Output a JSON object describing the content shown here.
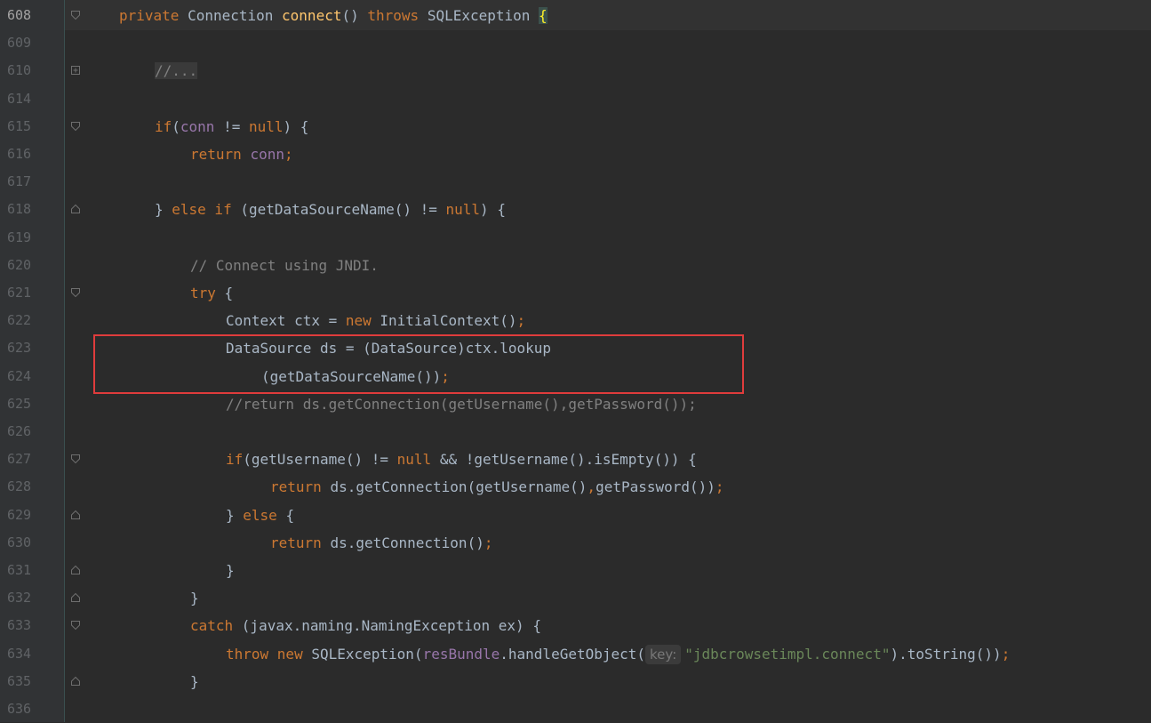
{
  "editor": {
    "lines": [
      {
        "num": "608",
        "current": true,
        "fold": "open",
        "indent": 0,
        "segments": [
          [
            "kw",
            "private "
          ],
          [
            "",
            "Connection "
          ],
          [
            "fn",
            "connect"
          ],
          [
            "",
            "() "
          ],
          [
            "kw",
            "throws "
          ],
          [
            "",
            "SQLException "
          ],
          [
            "brace-hl",
            "{"
          ]
        ]
      },
      {
        "num": "609",
        "fold": "none",
        "indent": 0,
        "segments": []
      },
      {
        "num": "610",
        "fold": "plus",
        "indent": 1,
        "segments": [
          [
            "folded",
            "//..."
          ]
        ]
      },
      {
        "num": "614",
        "fold": "none",
        "indent": 0,
        "segments": []
      },
      {
        "num": "615",
        "fold": "open",
        "indent": 1,
        "segments": [
          [
            "kw",
            "if"
          ],
          [
            "",
            "("
          ],
          [
            "field",
            "conn"
          ],
          [
            "",
            " != "
          ],
          [
            "kw",
            "null"
          ],
          [
            "",
            ") {"
          ]
        ]
      },
      {
        "num": "616",
        "fold": "none",
        "indent": 2,
        "segments": [
          [
            "kw",
            "return "
          ],
          [
            "field",
            "conn"
          ],
          [
            "kw",
            ";"
          ]
        ]
      },
      {
        "num": "617",
        "fold": "none",
        "indent": 0,
        "segments": []
      },
      {
        "num": "618",
        "fold": "close",
        "indent": 1,
        "segments": [
          [
            "",
            "} "
          ],
          [
            "kw",
            "else if "
          ],
          [
            "",
            "(getDataSourceName() != "
          ],
          [
            "kw",
            "null"
          ],
          [
            "",
            ") {"
          ]
        ]
      },
      {
        "num": "619",
        "fold": "none",
        "indent": 0,
        "segments": []
      },
      {
        "num": "620",
        "fold": "none",
        "indent": 2,
        "segments": [
          [
            "cm",
            "// Connect using JNDI."
          ]
        ]
      },
      {
        "num": "621",
        "fold": "open",
        "indent": 2,
        "segments": [
          [
            "kw",
            "try "
          ],
          [
            "",
            "{"
          ]
        ]
      },
      {
        "num": "622",
        "fold": "none",
        "indent": 3,
        "segments": [
          [
            "",
            "Context ctx = "
          ],
          [
            "kw",
            "new "
          ],
          [
            "",
            "InitialContext()"
          ],
          [
            "kw",
            ";"
          ]
        ]
      },
      {
        "num": "623",
        "fold": "none",
        "indent": 3,
        "segments": [
          [
            "",
            "DataSource ds = (DataSource)ctx.lookup"
          ]
        ]
      },
      {
        "num": "624",
        "fold": "none",
        "indent": 4,
        "segments": [
          [
            "",
            "(getDataSourceName())"
          ],
          [
            "kw",
            ";"
          ]
        ]
      },
      {
        "num": "625",
        "fold": "none",
        "indent": 3,
        "segments": [
          [
            "cm",
            "//return ds.getConnection(getUsername(),getPassword());"
          ]
        ]
      },
      {
        "num": "626",
        "fold": "none",
        "indent": 0,
        "segments": []
      },
      {
        "num": "627",
        "fold": "open",
        "indent": 3,
        "segments": [
          [
            "kw",
            "if"
          ],
          [
            "",
            "(getUsername() != "
          ],
          [
            "kw",
            "null "
          ],
          [
            "",
            "&& !getUsername().isEmpty()) {"
          ]
        ]
      },
      {
        "num": "628",
        "fold": "none",
        "indent": 5,
        "segments": [
          [
            "kw",
            "return "
          ],
          [
            "",
            "ds.getConnection(getUsername()"
          ],
          [
            "kw",
            ","
          ],
          [
            "",
            "getPassword())"
          ],
          [
            "kw",
            ";"
          ]
        ]
      },
      {
        "num": "629",
        "fold": "close",
        "indent": 3,
        "segments": [
          [
            "",
            "} "
          ],
          [
            "kw",
            "else "
          ],
          [
            "",
            "{"
          ]
        ]
      },
      {
        "num": "630",
        "fold": "none",
        "indent": 5,
        "segments": [
          [
            "kw",
            "return "
          ],
          [
            "",
            "ds.getConnection()"
          ],
          [
            "kw",
            ";"
          ]
        ]
      },
      {
        "num": "631",
        "fold": "close",
        "indent": 3,
        "segments": [
          [
            "",
            "}"
          ]
        ]
      },
      {
        "num": "632",
        "fold": "close",
        "indent": 2,
        "segments": [
          [
            "",
            "}"
          ]
        ]
      },
      {
        "num": "633",
        "fold": "open",
        "indent": 2,
        "segments": [
          [
            "kw",
            "catch "
          ],
          [
            "",
            "(javax.naming.NamingException ex) {"
          ]
        ]
      },
      {
        "num": "634",
        "fold": "none",
        "indent": 3,
        "segments": [
          [
            "kw",
            "throw new "
          ],
          [
            "",
            "SQLException("
          ],
          [
            "field",
            "resBundle"
          ],
          [
            "",
            ".handleGetObject("
          ],
          [
            "hint",
            "key:"
          ],
          [
            "str",
            "\"jdbcrowsetimpl.connect\""
          ],
          [
            "",
            ").toString())"
          ],
          [
            "kw",
            ";"
          ]
        ]
      },
      {
        "num": "635",
        "fold": "close",
        "indent": 2,
        "segments": [
          [
            "",
            "}"
          ]
        ]
      },
      {
        "num": "636",
        "fold": "none",
        "indent": 0,
        "segments": []
      }
    ]
  },
  "colors": {
    "background": "#2b2b2b",
    "keyword": "#cc7832",
    "function": "#ffc66d",
    "comment": "#808080",
    "string": "#6a8759",
    "field": "#9876aa",
    "highlight_box": "#e03c3c"
  }
}
